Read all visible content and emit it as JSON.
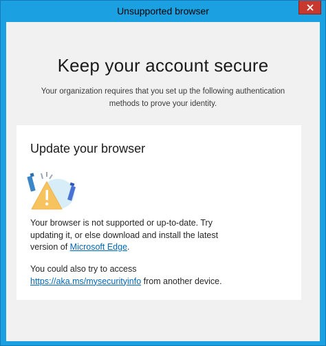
{
  "window": {
    "title": "Unsupported browser"
  },
  "page": {
    "heading": "Keep your account secure",
    "subheading": "Your organization requires that you set up the following authentication methods to prove your identity."
  },
  "card": {
    "title": "Update your browser",
    "paragraph1_text": "Your browser is not supported or up-to-date. Try updating it, or else download and install the latest version of ",
    "edge_link": "Microsoft Edge",
    "paragraph1_end": ".",
    "paragraph2_text": "You could also try to access ",
    "security_link": "https://aka.ms/mysecurityinfo",
    "paragraph2_end": " from another device."
  },
  "colors": {
    "titlebar": "#1ba1e2",
    "close": "#c7392f",
    "link": "#0067b8",
    "warning": "#f7c35f"
  }
}
